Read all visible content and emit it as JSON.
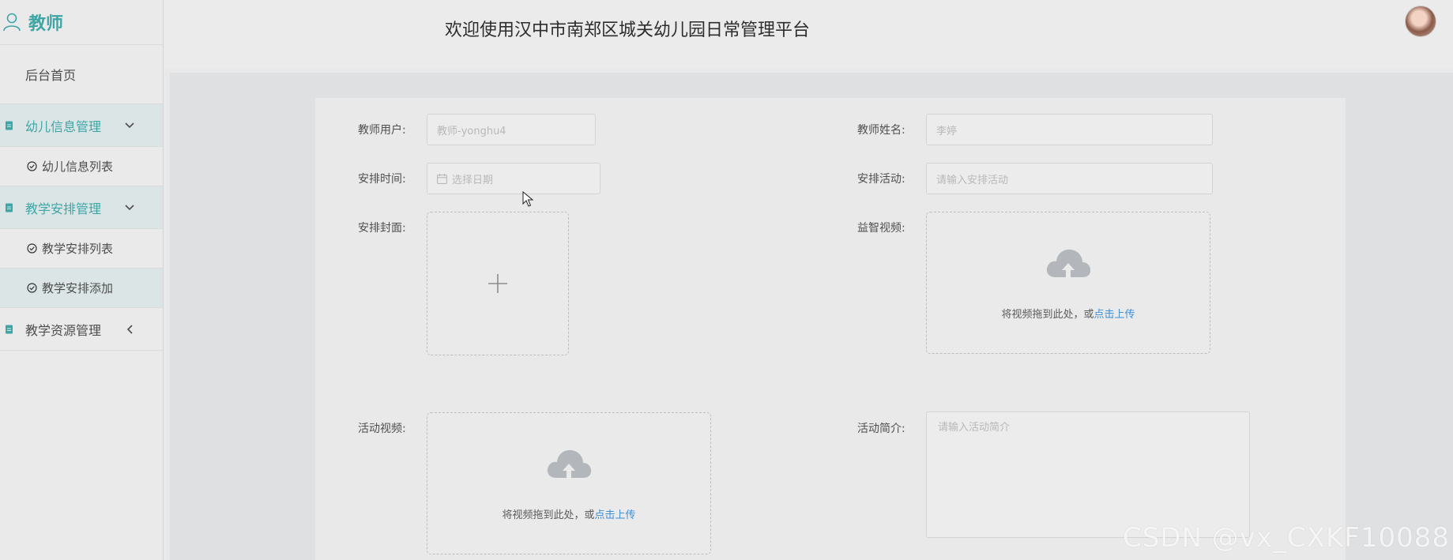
{
  "sidebar": {
    "brand": "教师",
    "home": "后台首页",
    "groups": [
      {
        "label": "幼儿信息管理",
        "items": [
          "幼儿信息列表"
        ]
      },
      {
        "label": "教学安排管理",
        "items": [
          "教学安排列表",
          "教学安排添加"
        ]
      },
      {
        "label": "教学资源管理",
        "items": []
      }
    ]
  },
  "header": {
    "title": "欢迎使用汉中市南郑区城关幼儿园日常管理平台"
  },
  "form": {
    "teacher_user": {
      "label": "教师用户:",
      "placeholder": "教师-yonghu4"
    },
    "teacher_name": {
      "label": "教师姓名:",
      "placeholder": "李婷"
    },
    "schedule_time": {
      "label": "安排时间:",
      "placeholder": "选择日期"
    },
    "schedule_activity": {
      "label": "安排活动:",
      "placeholder": "请输入安排活动"
    },
    "cover": {
      "label": "安排封面:"
    },
    "edu_video": {
      "label": "益智视频:",
      "drop_text": "将视频拖到此处，或",
      "link_text": "点击上传"
    },
    "activity_video": {
      "label": "活动视频:",
      "drop_text": "将视频拖到此处，或",
      "link_text": "点击上传"
    },
    "activity_intro": {
      "label": "活动简介:",
      "placeholder": "请输入活动简介"
    }
  },
  "watermark": "CSDN @vx_CXKF10088",
  "colors": {
    "accent": "#3fa6a6",
    "link": "#3d8fd6"
  }
}
